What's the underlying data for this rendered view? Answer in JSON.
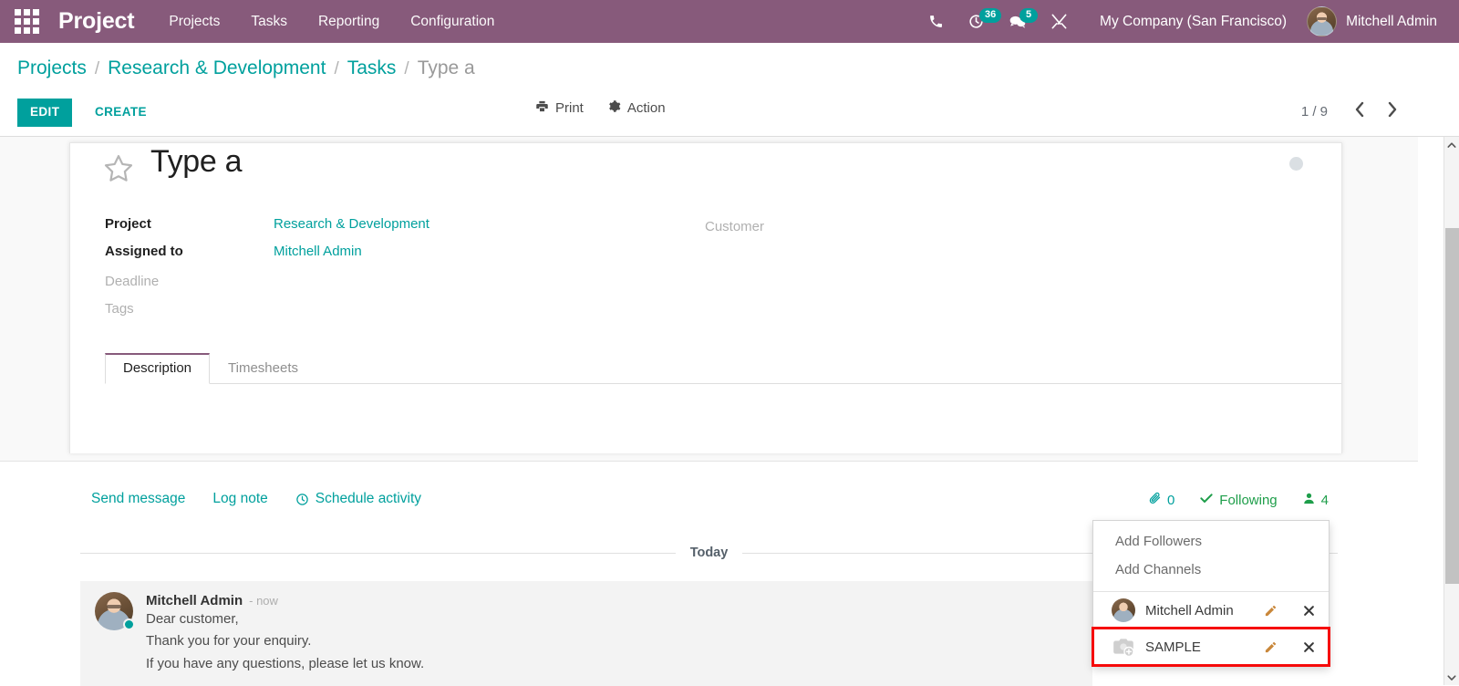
{
  "navbar": {
    "apps_icon": "apps-grid-icon",
    "brand": "Project",
    "menu": [
      {
        "label": "Projects"
      },
      {
        "label": "Tasks"
      },
      {
        "label": "Reporting"
      },
      {
        "label": "Configuration"
      }
    ],
    "icons": [
      {
        "name": "phone-icon",
        "badge": null
      },
      {
        "name": "activity-clock-icon",
        "badge": "36"
      },
      {
        "name": "messages-icon",
        "badge": "5"
      },
      {
        "name": "developer-tools-icon",
        "badge": null
      }
    ],
    "company": "My Company (San Francisco)",
    "user": "Mitchell Admin",
    "background_color": "#875a7b",
    "badge_color": "#00a09d"
  },
  "control_panel": {
    "breadcrumb": [
      {
        "label": "Projects",
        "link": true
      },
      {
        "label": "Research & Development",
        "link": true
      },
      {
        "label": "Tasks",
        "link": true
      },
      {
        "label": "Type a",
        "link": false
      }
    ],
    "separator": "/",
    "edit_label": "EDIT",
    "create_label": "CREATE",
    "print_label": "Print",
    "action_label": "Action",
    "pager": {
      "value": "1 / 9",
      "previous_icon": "chevron-left-icon",
      "next_icon": "chevron-right-icon"
    },
    "accent_color": "#00A09D"
  },
  "form": {
    "star_icon": "star-outline-icon",
    "title": "Type a",
    "kanban_state_dot": "grey",
    "fields_left": [
      {
        "label": "Project",
        "value": "Research & Development",
        "muted": false,
        "link": true
      },
      {
        "label": "Assigned to",
        "value": "Mitchell Admin",
        "muted": false,
        "link": true
      },
      {
        "label": "Deadline",
        "value": "",
        "muted": true,
        "link": false
      },
      {
        "label": "Tags",
        "value": "",
        "muted": true,
        "link": false
      }
    ],
    "fields_right": [
      {
        "label": "Customer",
        "value": "",
        "muted": true,
        "link": false
      }
    ],
    "tabs": [
      {
        "label": "Description",
        "active": true
      },
      {
        "label": "Timesheets",
        "active": false
      }
    ]
  },
  "chatter": {
    "actions": [
      {
        "label": "Send message",
        "icon": null
      },
      {
        "label": "Log note",
        "icon": null
      },
      {
        "label": "Schedule activity",
        "icon": "clock-icon"
      }
    ],
    "attachments": {
      "icon": "paperclip-icon",
      "count": "0"
    },
    "following": {
      "icon": "check-icon",
      "label": "Following"
    },
    "followers": {
      "icon": "user-icon",
      "count": "4"
    },
    "day_separator": "Today",
    "message": {
      "author": "Mitchell Admin",
      "time": "- now",
      "lines": [
        "Dear customer,",
        "Thank you for your enquiry.",
        "If you have any questions, please let us know."
      ]
    }
  },
  "followers_dropdown": {
    "add_followers_label": "Add Followers",
    "add_channels_label": "Add Channels",
    "rows": [
      {
        "name": "Mitchell Admin",
        "avatar": "photo",
        "edit_icon": "pencil-icon",
        "remove_icon": "close-icon",
        "highlighted": false
      },
      {
        "name": "SAMPLE",
        "avatar": "camera-placeholder-icon",
        "edit_icon": "pencil-icon",
        "remove_icon": "close-icon",
        "highlighted": true
      }
    ],
    "highlight_color": "#f60a0a"
  },
  "scrollbar": {
    "up_icon": "chevron-up-icon",
    "down_icon": "chevron-down-icon"
  }
}
